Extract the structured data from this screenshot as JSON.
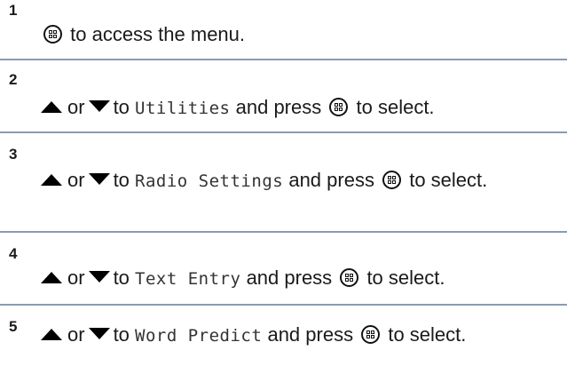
{
  "steps": [
    {
      "number": "1",
      "text_after_icon": "to access the menu."
    },
    {
      "number": "2",
      "or": "or",
      "to": "to",
      "menu_item": "Utilities",
      "and_press": "and press",
      "end": "to select."
    },
    {
      "number": "3",
      "or": "or",
      "to": "to",
      "menu_item": "Radio Settings",
      "and_press": "and press",
      "end": "to select."
    },
    {
      "number": "4",
      "or": "or",
      "to": "to",
      "menu_item": "Text Entry",
      "and_press": "and press",
      "end": "to select."
    },
    {
      "number": "5",
      "or": "or",
      "to": "to",
      "menu_item": "Word Predict",
      "and_press": "and press",
      "end": "to select."
    }
  ],
  "icons": {
    "menu_ok": "menu-ok-button-icon",
    "up": "up-arrow-icon",
    "down": "down-arrow-icon"
  },
  "colors": {
    "divider": "#8a9bb0"
  }
}
